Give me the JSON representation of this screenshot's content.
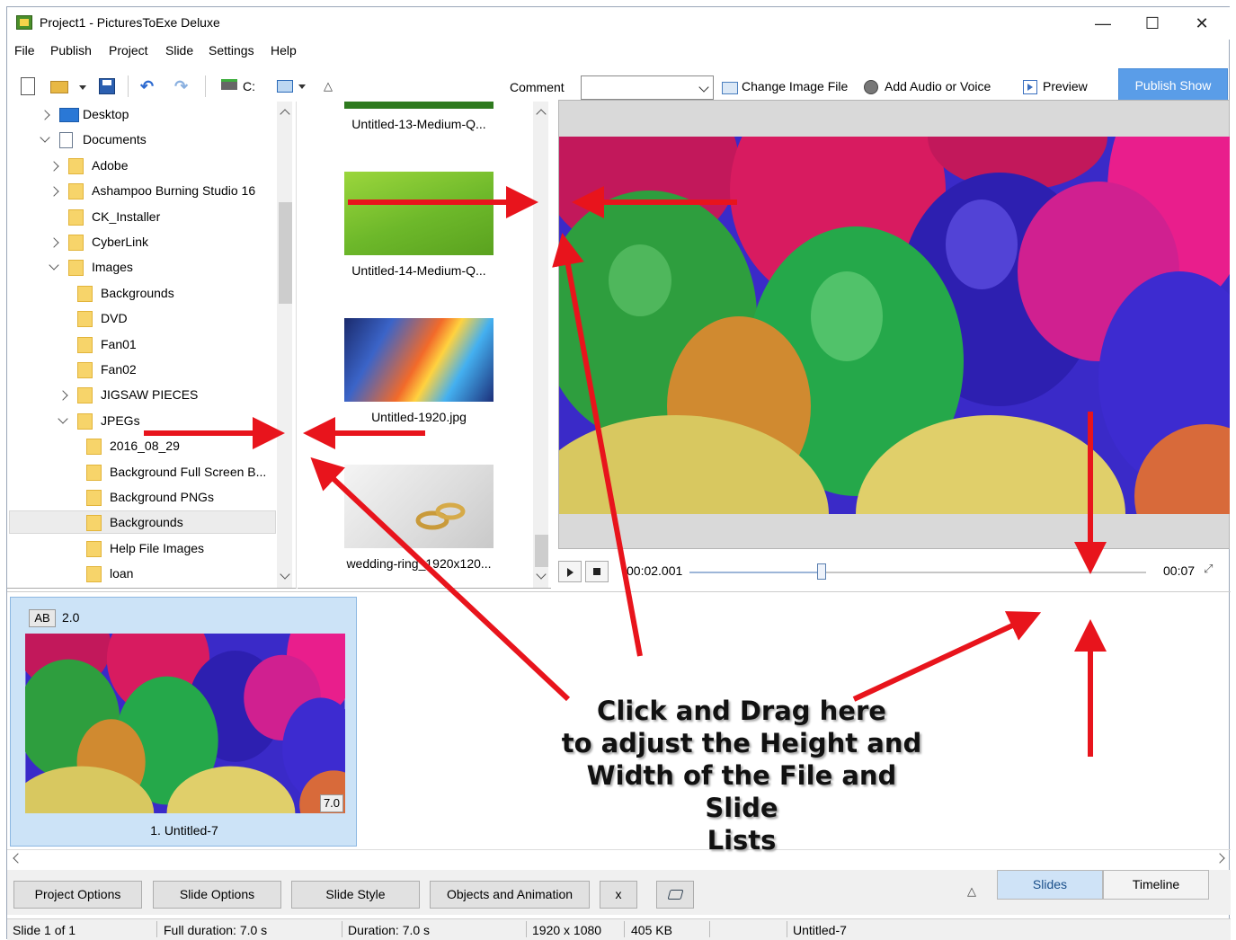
{
  "window": {
    "title": "Project1 - PicturesToExe Deluxe",
    "controls": {
      "minimize": "—",
      "maximize": "☐",
      "close": "✕"
    }
  },
  "menu": [
    "File",
    "Publish",
    "Project",
    "Slide",
    "Settings",
    "Help"
  ],
  "toolbar": {
    "drive_label": "C:",
    "comment_label": "Comment",
    "comment_value": "",
    "change_image_label": "Change Image File",
    "add_audio_label": "Add Audio or Voice",
    "preview_label": "Preview",
    "publish_label": "Publish Show"
  },
  "tree": [
    {
      "label": "Desktop",
      "expander": "closed"
    },
    {
      "label": "Documents",
      "expander": "open"
    },
    {
      "label": "Adobe",
      "expander": "closed"
    },
    {
      "label": "Ashampoo Burning Studio 16",
      "expander": "closed"
    },
    {
      "label": "CK_Installer",
      "expander": "none"
    },
    {
      "label": "CyberLink",
      "expander": "closed"
    },
    {
      "label": "Images",
      "expander": "open"
    },
    {
      "label": "Backgrounds",
      "expander": "none"
    },
    {
      "label": "DVD",
      "expander": "none"
    },
    {
      "label": "Fan01",
      "expander": "none"
    },
    {
      "label": "Fan02",
      "expander": "none"
    },
    {
      "label": "JIGSAW PIECES",
      "expander": "closed"
    },
    {
      "label": "JPEGs",
      "expander": "open"
    },
    {
      "label": "2016_08_29",
      "expander": "none"
    },
    {
      "label": "Background Full Screen B...",
      "expander": "none"
    },
    {
      "label": "Background PNGs",
      "expander": "none"
    },
    {
      "label": "Backgrounds",
      "expander": "none",
      "selected": true
    },
    {
      "label": "Help File Images",
      "expander": "none"
    },
    {
      "label": "loan",
      "expander": "none"
    }
  ],
  "files": [
    {
      "name": "Untitled-13-Medium-Q..."
    },
    {
      "name": "Untitled-14-Medium-Q..."
    },
    {
      "name": "Untitled-1920.jpg"
    },
    {
      "name": "wedding-ring_1920x120..."
    }
  ],
  "player": {
    "current_time": "00:02.001",
    "total_time": "00:07",
    "position_fraction": 0.29
  },
  "slides": [
    {
      "badge": "AB",
      "transition": "2.0",
      "duration": "7.0",
      "name": "1. Untitled-7"
    }
  ],
  "bottom_buttons": [
    "Project Options",
    "Slide Options",
    "Slide Style",
    "Objects and Animation",
    "x"
  ],
  "tabs": {
    "slides": "Slides",
    "timeline": "Timeline"
  },
  "status": {
    "slide": "Slide 1 of 1",
    "full_duration": "Full duration: 7.0 s",
    "duration": "Duration: 7.0 s",
    "resolution": "1920 x 1080",
    "size": "405 KB",
    "name": "Untitled-7"
  },
  "callout": [
    "Click and Drag here",
    "to adjust the Height and",
    "Width of the File and Slide",
    "Lists"
  ],
  "colors": {
    "arrow": "#e8141c",
    "publish": "#5a9de8",
    "slide_selected": "#cce3f7"
  }
}
